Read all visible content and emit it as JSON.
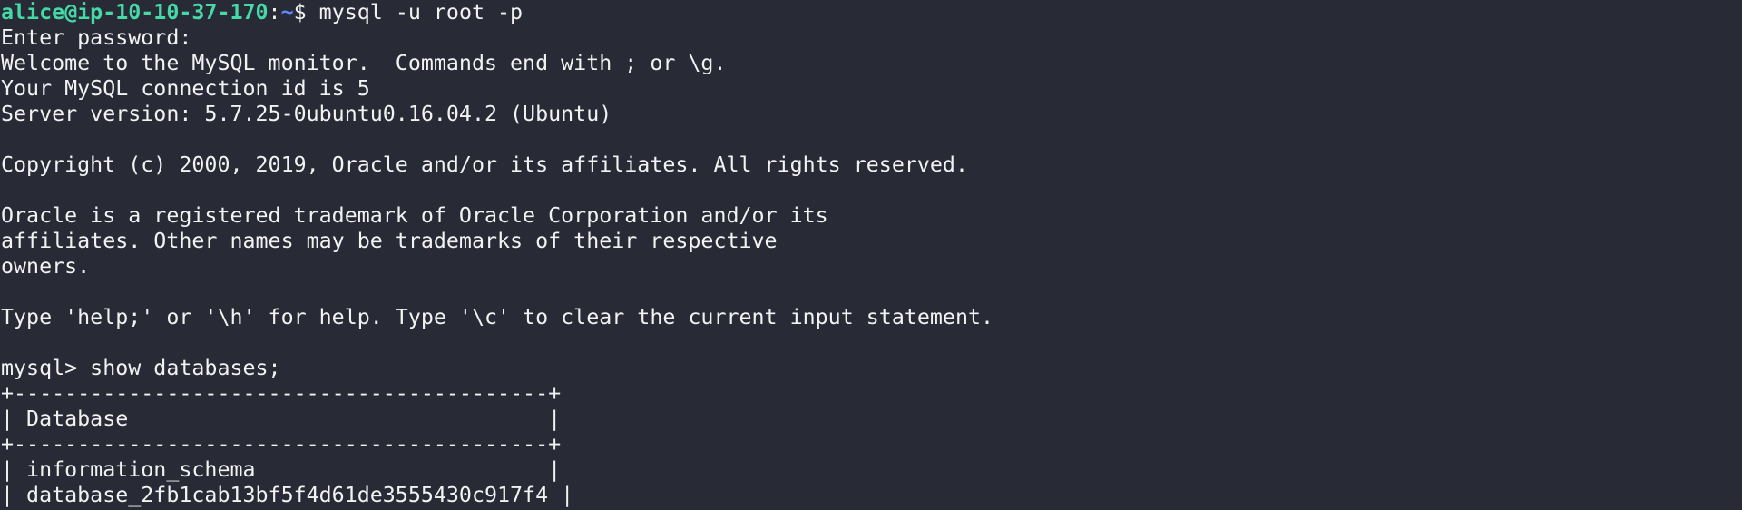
{
  "colors": {
    "background": "#282a36",
    "foreground": "#f2f2f2",
    "prompt_user": "#46d9a8",
    "prompt_path": "#5f87ff"
  },
  "shell_prompt": {
    "user_host": "alice@ip-10-10-37-170",
    "colon": ":",
    "path": "~",
    "dollar": "$",
    "command": " mysql -u root -p"
  },
  "output": {
    "enter_password": "Enter password:",
    "welcome": "Welcome to the MySQL monitor.  Commands end with ; or \\g.",
    "connection_id": "Your MySQL connection id is 5",
    "server_version": "Server version: 5.7.25-0ubuntu0.16.04.2 (Ubuntu)",
    "blank1": "",
    "copyright": "Copyright (c) 2000, 2019, Oracle and/or its affiliates. All rights reserved.",
    "blank2": "",
    "trademark_1": "Oracle is a registered trademark of Oracle Corporation and/or its",
    "trademark_2": "affiliates. Other names may be trademarks of their respective",
    "trademark_3": "owners.",
    "blank3": "",
    "help": "Type 'help;' or '\\h' for help. Type '\\c' to clear the current input statement.",
    "blank4": ""
  },
  "mysql_session": {
    "prompt_and_command": "mysql> show databases;",
    "table_border_top": "+------------------------------------------+",
    "table_header": "| Database                                 |",
    "table_border_mid": "+------------------------------------------+",
    "rows": [
      "| information_schema                       |",
      "| database_2fb1cab13bf5f4d61de3555430c917f4 |"
    ]
  }
}
